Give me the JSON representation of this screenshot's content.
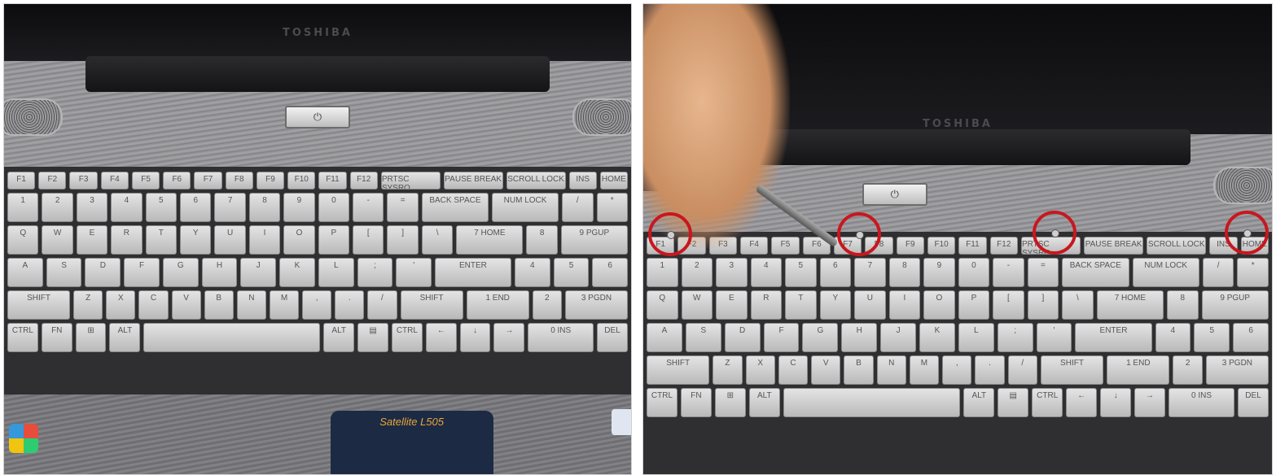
{
  "photos": [
    {
      "id": "left",
      "brand": "TOSHIBA",
      "model_badge": "Satellite L505",
      "power_symbol": "⏻"
    },
    {
      "id": "right",
      "brand": "TOSHIBA",
      "power_symbol": "⏻",
      "highlight_color": "#c8171e",
      "highlighted_screws": 4
    }
  ],
  "keyboard": {
    "fn_row": [
      "F1",
      "F2",
      "F3",
      "F4",
      "F5",
      "F6",
      "F7",
      "F8",
      "F9",
      "F10",
      "F11",
      "F12",
      "PRTSC SYSRQ",
      "PAUSE BREAK",
      "SCROLL LOCK",
      "INS",
      "HOME"
    ],
    "num_row": [
      "1",
      "2",
      "3",
      "4",
      "5",
      "6",
      "7",
      "8",
      "9",
      "0",
      "-",
      "=",
      "BACK SPACE",
      "NUM LOCK",
      "/",
      "*"
    ],
    "q_row": [
      "Q",
      "W",
      "E",
      "R",
      "T",
      "Y",
      "U",
      "I",
      "O",
      "P",
      "[",
      "]",
      "\\",
      "7 HOME",
      "8",
      "9 PGUP"
    ],
    "a_row": [
      "A",
      "S",
      "D",
      "F",
      "G",
      "H",
      "J",
      "K",
      "L",
      ";",
      "'",
      "ENTER",
      "4",
      "5",
      "6"
    ],
    "z_row": [
      "SHIFT",
      "Z",
      "X",
      "C",
      "V",
      "B",
      "N",
      "M",
      ",",
      ".",
      "/",
      "SHIFT",
      "1 END",
      "2",
      "3 PGDN"
    ],
    "space_row": [
      "CTRL",
      "FN",
      "⊞",
      "ALT",
      "",
      "ALT",
      "▤",
      "CTRL",
      "←",
      "↓",
      "→",
      "0 INS",
      "DEL"
    ]
  }
}
